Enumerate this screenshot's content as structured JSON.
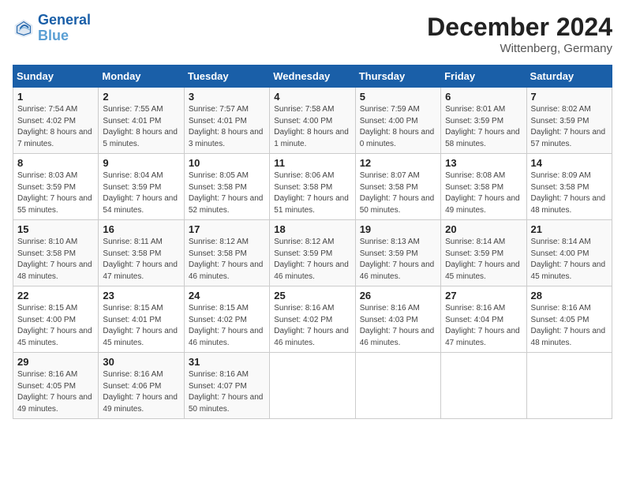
{
  "header": {
    "logo_line1": "General",
    "logo_line2": "Blue",
    "month_title": "December 2024",
    "location": "Wittenberg, Germany"
  },
  "weekdays": [
    "Sunday",
    "Monday",
    "Tuesday",
    "Wednesday",
    "Thursday",
    "Friday",
    "Saturday"
  ],
  "weeks": [
    [
      {
        "day": "1",
        "sunrise": "Sunrise: 7:54 AM",
        "sunset": "Sunset: 4:02 PM",
        "daylight": "Daylight: 8 hours and 7 minutes."
      },
      {
        "day": "2",
        "sunrise": "Sunrise: 7:55 AM",
        "sunset": "Sunset: 4:01 PM",
        "daylight": "Daylight: 8 hours and 5 minutes."
      },
      {
        "day": "3",
        "sunrise": "Sunrise: 7:57 AM",
        "sunset": "Sunset: 4:01 PM",
        "daylight": "Daylight: 8 hours and 3 minutes."
      },
      {
        "day": "4",
        "sunrise": "Sunrise: 7:58 AM",
        "sunset": "Sunset: 4:00 PM",
        "daylight": "Daylight: 8 hours and 1 minute."
      },
      {
        "day": "5",
        "sunrise": "Sunrise: 7:59 AM",
        "sunset": "Sunset: 4:00 PM",
        "daylight": "Daylight: 8 hours and 0 minutes."
      },
      {
        "day": "6",
        "sunrise": "Sunrise: 8:01 AM",
        "sunset": "Sunset: 3:59 PM",
        "daylight": "Daylight: 7 hours and 58 minutes."
      },
      {
        "day": "7",
        "sunrise": "Sunrise: 8:02 AM",
        "sunset": "Sunset: 3:59 PM",
        "daylight": "Daylight: 7 hours and 57 minutes."
      }
    ],
    [
      {
        "day": "8",
        "sunrise": "Sunrise: 8:03 AM",
        "sunset": "Sunset: 3:59 PM",
        "daylight": "Daylight: 7 hours and 55 minutes."
      },
      {
        "day": "9",
        "sunrise": "Sunrise: 8:04 AM",
        "sunset": "Sunset: 3:59 PM",
        "daylight": "Daylight: 7 hours and 54 minutes."
      },
      {
        "day": "10",
        "sunrise": "Sunrise: 8:05 AM",
        "sunset": "Sunset: 3:58 PM",
        "daylight": "Daylight: 7 hours and 52 minutes."
      },
      {
        "day": "11",
        "sunrise": "Sunrise: 8:06 AM",
        "sunset": "Sunset: 3:58 PM",
        "daylight": "Daylight: 7 hours and 51 minutes."
      },
      {
        "day": "12",
        "sunrise": "Sunrise: 8:07 AM",
        "sunset": "Sunset: 3:58 PM",
        "daylight": "Daylight: 7 hours and 50 minutes."
      },
      {
        "day": "13",
        "sunrise": "Sunrise: 8:08 AM",
        "sunset": "Sunset: 3:58 PM",
        "daylight": "Daylight: 7 hours and 49 minutes."
      },
      {
        "day": "14",
        "sunrise": "Sunrise: 8:09 AM",
        "sunset": "Sunset: 3:58 PM",
        "daylight": "Daylight: 7 hours and 48 minutes."
      }
    ],
    [
      {
        "day": "15",
        "sunrise": "Sunrise: 8:10 AM",
        "sunset": "Sunset: 3:58 PM",
        "daylight": "Daylight: 7 hours and 48 minutes."
      },
      {
        "day": "16",
        "sunrise": "Sunrise: 8:11 AM",
        "sunset": "Sunset: 3:58 PM",
        "daylight": "Daylight: 7 hours and 47 minutes."
      },
      {
        "day": "17",
        "sunrise": "Sunrise: 8:12 AM",
        "sunset": "Sunset: 3:58 PM",
        "daylight": "Daylight: 7 hours and 46 minutes."
      },
      {
        "day": "18",
        "sunrise": "Sunrise: 8:12 AM",
        "sunset": "Sunset: 3:59 PM",
        "daylight": "Daylight: 7 hours and 46 minutes."
      },
      {
        "day": "19",
        "sunrise": "Sunrise: 8:13 AM",
        "sunset": "Sunset: 3:59 PM",
        "daylight": "Daylight: 7 hours and 46 minutes."
      },
      {
        "day": "20",
        "sunrise": "Sunrise: 8:14 AM",
        "sunset": "Sunset: 3:59 PM",
        "daylight": "Daylight: 7 hours and 45 minutes."
      },
      {
        "day": "21",
        "sunrise": "Sunrise: 8:14 AM",
        "sunset": "Sunset: 4:00 PM",
        "daylight": "Daylight: 7 hours and 45 minutes."
      }
    ],
    [
      {
        "day": "22",
        "sunrise": "Sunrise: 8:15 AM",
        "sunset": "Sunset: 4:00 PM",
        "daylight": "Daylight: 7 hours and 45 minutes."
      },
      {
        "day": "23",
        "sunrise": "Sunrise: 8:15 AM",
        "sunset": "Sunset: 4:01 PM",
        "daylight": "Daylight: 7 hours and 45 minutes."
      },
      {
        "day": "24",
        "sunrise": "Sunrise: 8:15 AM",
        "sunset": "Sunset: 4:02 PM",
        "daylight": "Daylight: 7 hours and 46 minutes."
      },
      {
        "day": "25",
        "sunrise": "Sunrise: 8:16 AM",
        "sunset": "Sunset: 4:02 PM",
        "daylight": "Daylight: 7 hours and 46 minutes."
      },
      {
        "day": "26",
        "sunrise": "Sunrise: 8:16 AM",
        "sunset": "Sunset: 4:03 PM",
        "daylight": "Daylight: 7 hours and 46 minutes."
      },
      {
        "day": "27",
        "sunrise": "Sunrise: 8:16 AM",
        "sunset": "Sunset: 4:04 PM",
        "daylight": "Daylight: 7 hours and 47 minutes."
      },
      {
        "day": "28",
        "sunrise": "Sunrise: 8:16 AM",
        "sunset": "Sunset: 4:05 PM",
        "daylight": "Daylight: 7 hours and 48 minutes."
      }
    ],
    [
      {
        "day": "29",
        "sunrise": "Sunrise: 8:16 AM",
        "sunset": "Sunset: 4:05 PM",
        "daylight": "Daylight: 7 hours and 49 minutes."
      },
      {
        "day": "30",
        "sunrise": "Sunrise: 8:16 AM",
        "sunset": "Sunset: 4:06 PM",
        "daylight": "Daylight: 7 hours and 49 minutes."
      },
      {
        "day": "31",
        "sunrise": "Sunrise: 8:16 AM",
        "sunset": "Sunset: 4:07 PM",
        "daylight": "Daylight: 7 hours and 50 minutes."
      },
      null,
      null,
      null,
      null
    ]
  ]
}
